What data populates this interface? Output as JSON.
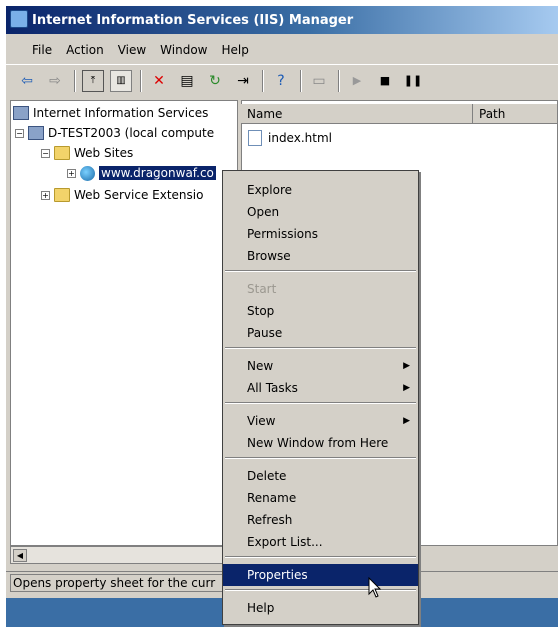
{
  "window": {
    "title": "Internet Information Services (IIS) Manager"
  },
  "menubar": {
    "items": [
      "File",
      "Action",
      "View",
      "Window",
      "Help"
    ]
  },
  "toolbar": {
    "icons": [
      "back-arrow-icon",
      "forward-arrow-icon",
      "up-folder-icon",
      "show-tree-icon",
      "delete-icon",
      "properties-icon",
      "refresh-icon",
      "export-icon",
      "help-icon",
      "computer-icon",
      "play-icon",
      "stop-icon",
      "pause-icon"
    ]
  },
  "tree": {
    "root": "Internet Information Services",
    "server": "D-TEST2003 (local compute",
    "web_sites": "Web Sites",
    "site": "www.dragonwaf.co",
    "extensions": "Web Service Extensio"
  },
  "list": {
    "columns": [
      "Name",
      "Path"
    ],
    "rows": [
      {
        "name": "index.html"
      }
    ]
  },
  "statusbar": {
    "text": "Opens property sheet for the curr"
  },
  "context_menu": {
    "items": [
      {
        "label": "Explore"
      },
      {
        "label": "Open"
      },
      {
        "label": "Permissions"
      },
      {
        "label": "Browse"
      },
      {
        "label": "Start",
        "disabled": true
      },
      {
        "label": "Stop"
      },
      {
        "label": "Pause"
      },
      {
        "label": "New",
        "submenu": true
      },
      {
        "label": "All Tasks",
        "submenu": true
      },
      {
        "label": "View",
        "submenu": true
      },
      {
        "label": "New Window from Here"
      },
      {
        "label": "Delete"
      },
      {
        "label": "Rename"
      },
      {
        "label": "Refresh"
      },
      {
        "label": "Export List..."
      },
      {
        "label": "Properties",
        "highlighted": true
      },
      {
        "label": "Help"
      }
    ]
  }
}
